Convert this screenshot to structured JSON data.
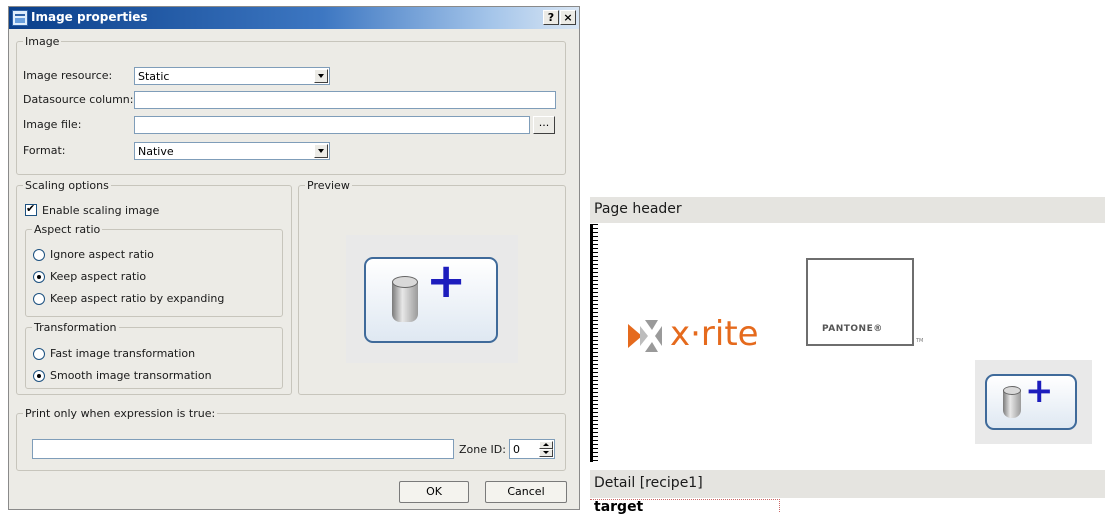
{
  "dialog": {
    "title": "Image properties",
    "help_button": "?",
    "close_button": "×",
    "image_group": {
      "legend": "Image",
      "resource_label": "Image resource:",
      "resource_value": "Static",
      "datasource_label": "Datasource column:",
      "datasource_value": "",
      "file_label": "Image file:",
      "file_value": "",
      "browse_button": "...",
      "format_label": "Format:",
      "format_value": "Native"
    },
    "scaling": {
      "legend": "Scaling options",
      "enable_label": "Enable scaling image",
      "enable_checked": true,
      "aspect": {
        "legend": "Aspect ratio",
        "options": [
          "Ignore aspect ratio",
          "Keep aspect ratio",
          "Keep aspect ratio by expanding"
        ],
        "selected_index": 1
      },
      "transform": {
        "legend": "Transformation",
        "options": [
          "Fast image transformation",
          "Smooth image transormation"
        ],
        "selected_index": 1
      }
    },
    "preview": {
      "legend": "Preview",
      "icon": "add-image-icon"
    },
    "print": {
      "legend": "Print only when expression is true:",
      "expression_value": "",
      "zone_label": "Zone ID:",
      "zone_value": "0"
    },
    "ok_button": "OK",
    "cancel_button": "Cancel"
  },
  "report": {
    "page_header_label": "Page header",
    "logos": {
      "xrite": "x·rite",
      "pantone": "PANTONE®",
      "pantone_tm": "TM"
    },
    "detail_label": "Detail [recipe1]",
    "detail_field": "target"
  },
  "colors": {
    "title_gradient_start": "#0a3f8a",
    "xrite_orange": "#e56a1d",
    "plus_blue": "#1d1dbd"
  }
}
